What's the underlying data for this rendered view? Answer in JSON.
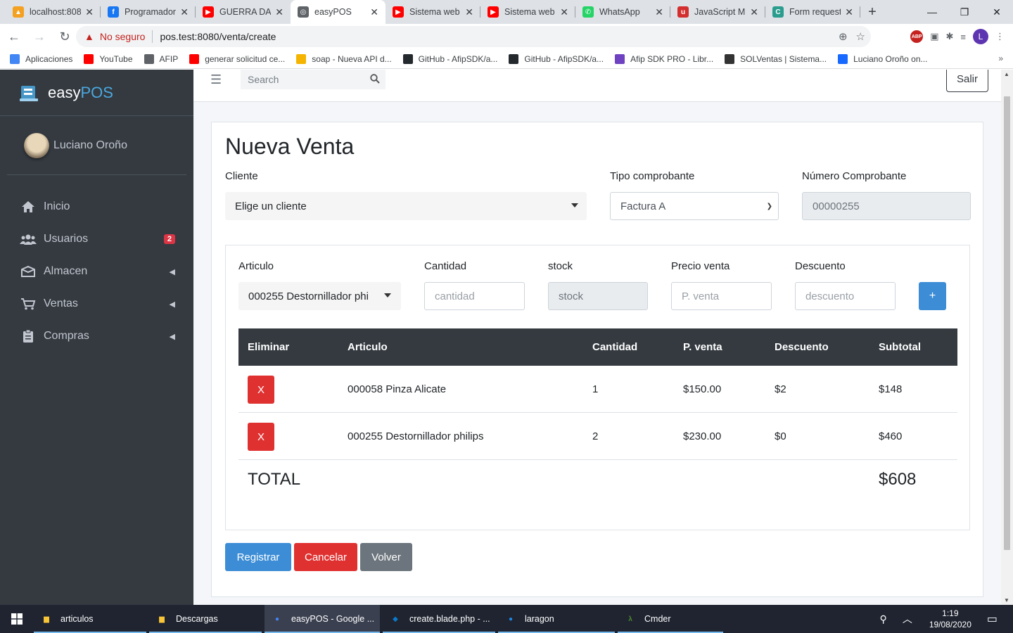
{
  "browser": {
    "tabs": [
      {
        "title": "localhost:808",
        "color": "#f4a020",
        "glyph": "▲"
      },
      {
        "title": "Programador",
        "color": "#1877f2",
        "glyph": "f"
      },
      {
        "title": "GUERRA DA C",
        "color": "#ff0000",
        "glyph": "▶"
      },
      {
        "title": "easyPOS",
        "color": "#5f6368",
        "glyph": "◎"
      },
      {
        "title": "Sistema web",
        "color": "#ff0000",
        "glyph": "▶"
      },
      {
        "title": "Sistema web",
        "color": "#ff0000",
        "glyph": "▶"
      },
      {
        "title": "WhatsApp",
        "color": "#25d366",
        "glyph": "✆"
      },
      {
        "title": "JavaScript M",
        "color": "#d32f2f",
        "glyph": "u"
      },
      {
        "title": "Form request",
        "color": "#2a9d8f",
        "glyph": "C"
      }
    ],
    "security_label": "No seguro",
    "url": "pos.test:8080/venta/create",
    "avatar_letter": "L",
    "bookmarks": [
      {
        "label": "Aplicaciones",
        "color": "#4285f4"
      },
      {
        "label": "YouTube",
        "color": "#ff0000"
      },
      {
        "label": "AFIP",
        "color": "#5f6368"
      },
      {
        "label": "generar solicitud ce...",
        "color": "#ff0000"
      },
      {
        "label": "soap - Nueva API d...",
        "color": "#f4b400"
      },
      {
        "label": "GitHub - AfipSDK/a...",
        "color": "#24292e"
      },
      {
        "label": "GitHub - AfipSDK/a...",
        "color": "#24292e"
      },
      {
        "label": "Afip SDK PRO - Libr...",
        "color": "#6f42c1"
      },
      {
        "label": "SOLVentas | Sistema...",
        "color": "#333333"
      },
      {
        "label": "Luciano Oroño on...",
        "color": "#1769ff"
      }
    ]
  },
  "app": {
    "brand_prefix": "easy",
    "brand_suffix": "POS",
    "user_name": "Luciano Oroño",
    "nav": [
      {
        "label": "Inicio",
        "badge": null,
        "chevron": false
      },
      {
        "label": "Usuarios",
        "badge": "2",
        "chevron": false
      },
      {
        "label": "Almacen",
        "badge": null,
        "chevron": true
      },
      {
        "label": "Ventas",
        "badge": null,
        "chevron": true
      },
      {
        "label": "Compras",
        "badge": null,
        "chevron": true
      }
    ],
    "search_placeholder": "Search",
    "logout_label": "Salir"
  },
  "form": {
    "title": "Nueva Venta",
    "cliente_label": "Cliente",
    "cliente_value": "Elige un cliente",
    "tipo_label": "Tipo comprobante",
    "tipo_value": "Factura A",
    "numero_label": "Número Comprobante",
    "numero_value": "00000255",
    "articulo_label": "Articulo",
    "articulo_value": "000255 Destornillador phi",
    "cantidad_label": "Cantidad",
    "cantidad_placeholder": "cantidad",
    "stock_label": "stock",
    "stock_placeholder": "stock",
    "precio_label": "Precio venta",
    "precio_placeholder": "P. venta",
    "descuento_label": "Descuento",
    "descuento_placeholder": "descuento",
    "add_label": "+"
  },
  "table": {
    "headers": [
      "Eliminar",
      "Articulo",
      "Cantidad",
      "P. venta",
      "Descuento",
      "Subtotal"
    ],
    "rows": [
      {
        "delete": "X",
        "articulo": "000058 Pinza Alicate",
        "cantidad": "1",
        "precio": "$150.00",
        "descuento": "$2",
        "subtotal": "$148"
      },
      {
        "delete": "X",
        "articulo": "000255 Destornillador philips",
        "cantidad": "2",
        "precio": "$230.00",
        "descuento": "$0",
        "subtotal": "$460"
      }
    ],
    "total_label": "TOTAL",
    "total_value": "$608"
  },
  "actions": {
    "registrar": "Registrar",
    "cancelar": "Cancelar",
    "volver": "Volver"
  },
  "taskbar": {
    "items": [
      {
        "label": "articulos",
        "color": "#f8c537"
      },
      {
        "label": "Descargas",
        "color": "#f8c537"
      },
      {
        "label": "easyPOS - Google ...",
        "color": "#4285f4"
      },
      {
        "label": "create.blade.php - ...",
        "color": "#0a7acc"
      },
      {
        "label": "laragon",
        "color": "#1e88e5"
      },
      {
        "label": "Cmder",
        "color": "#4c8c2b"
      }
    ],
    "time": "1:19",
    "date": "19/08/2020"
  },
  "colors": {
    "sidebar_bg": "#343a40",
    "primary": "#3c8dd6",
    "danger": "#e03131",
    "secondary": "#6c757d"
  }
}
